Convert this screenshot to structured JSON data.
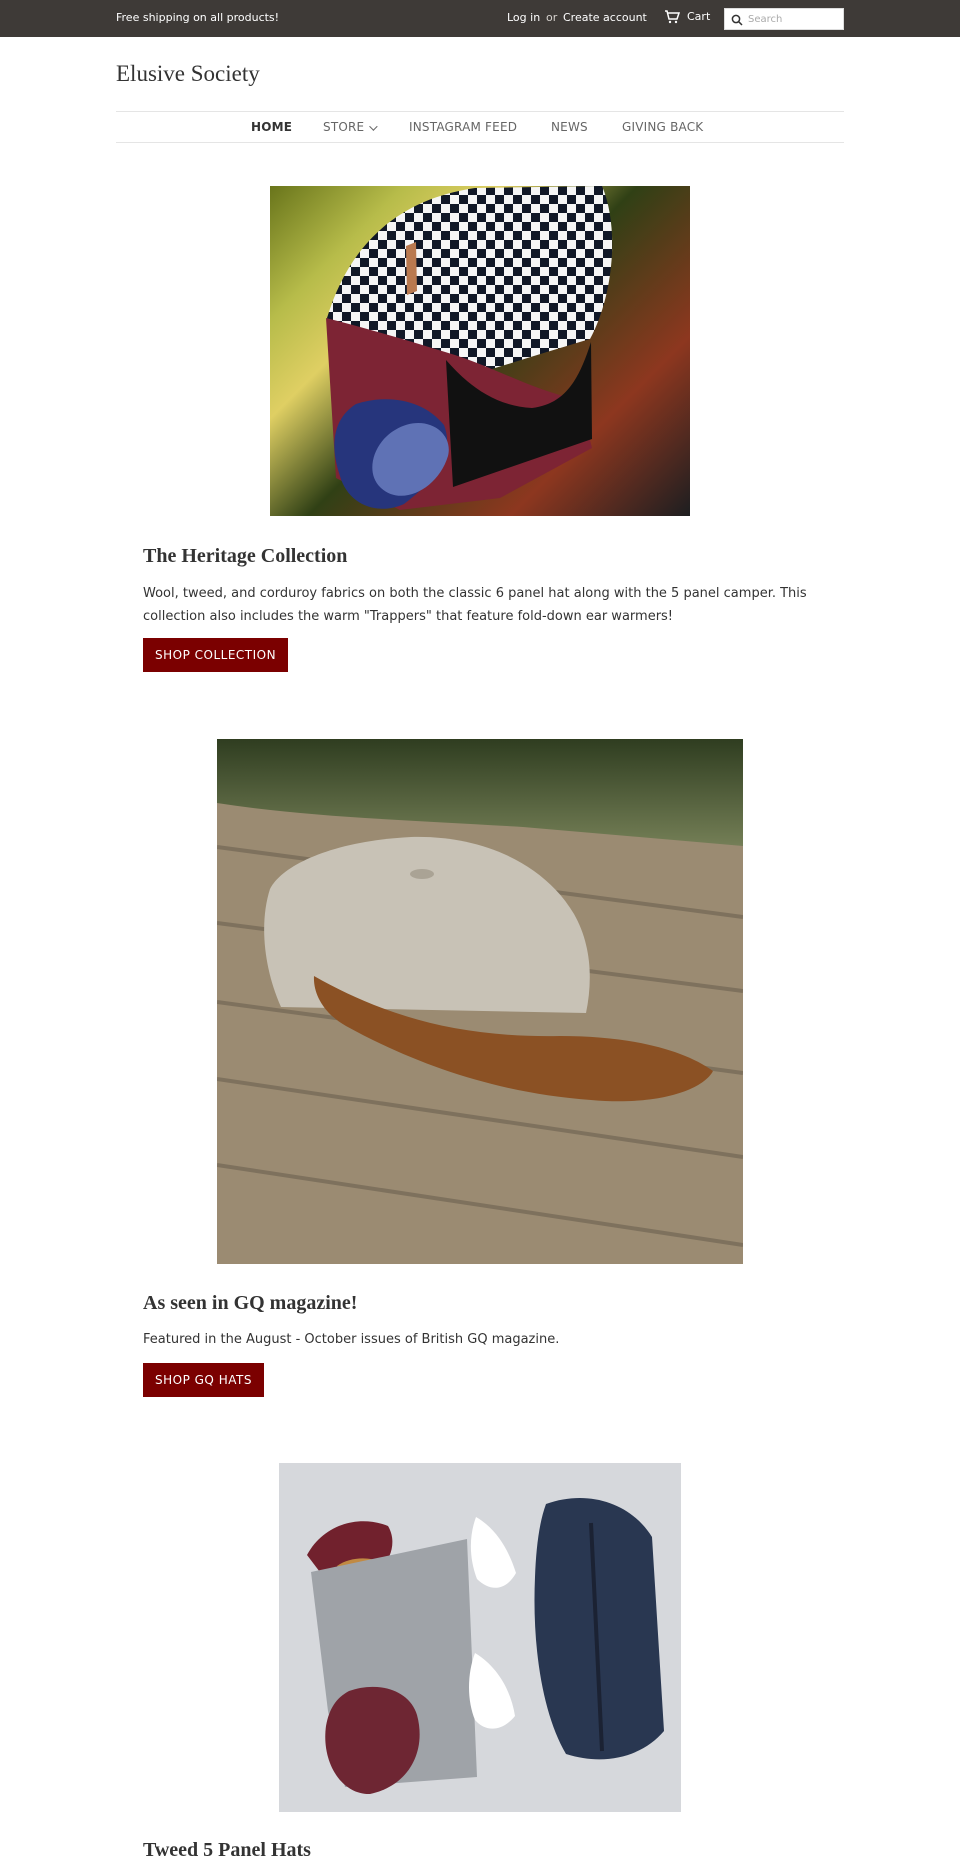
{
  "topbar": {
    "promo": "Free shipping on all products!",
    "login": "Log in",
    "or": "or",
    "create_account": "Create account",
    "cart": "Cart",
    "search_placeholder": "Search"
  },
  "site": {
    "title": "Elusive Society"
  },
  "nav": {
    "items": [
      {
        "label": "HOME"
      },
      {
        "label": "STORE"
      },
      {
        "label": "INSTAGRAM FEED"
      },
      {
        "label": "NEWS"
      },
      {
        "label": "GIVING BACK"
      }
    ]
  },
  "sections": [
    {
      "title": "The Heritage Collection",
      "text": "Wool, tweed, and corduroy fabrics on both the classic 6 panel hat along with the 5 panel camper. This collection also includes the warm \"Trappers\" that feature fold-down ear warmers!",
      "button": "SHOP COLLECTION"
    },
    {
      "title": "As seen in GQ magazine!",
      "text": "Featured in the August - October issues of British GQ magazine.",
      "button": "SHOP GQ HATS"
    },
    {
      "title": "Tweed 5 Panel Hats"
    }
  ],
  "colors": {
    "topbar": "#3e3a37",
    "button": "#7b0000",
    "text": "#333333"
  },
  "icons": {
    "cart": "cart-icon",
    "search": "search-icon",
    "dropdown": "chevron-down-icon"
  }
}
